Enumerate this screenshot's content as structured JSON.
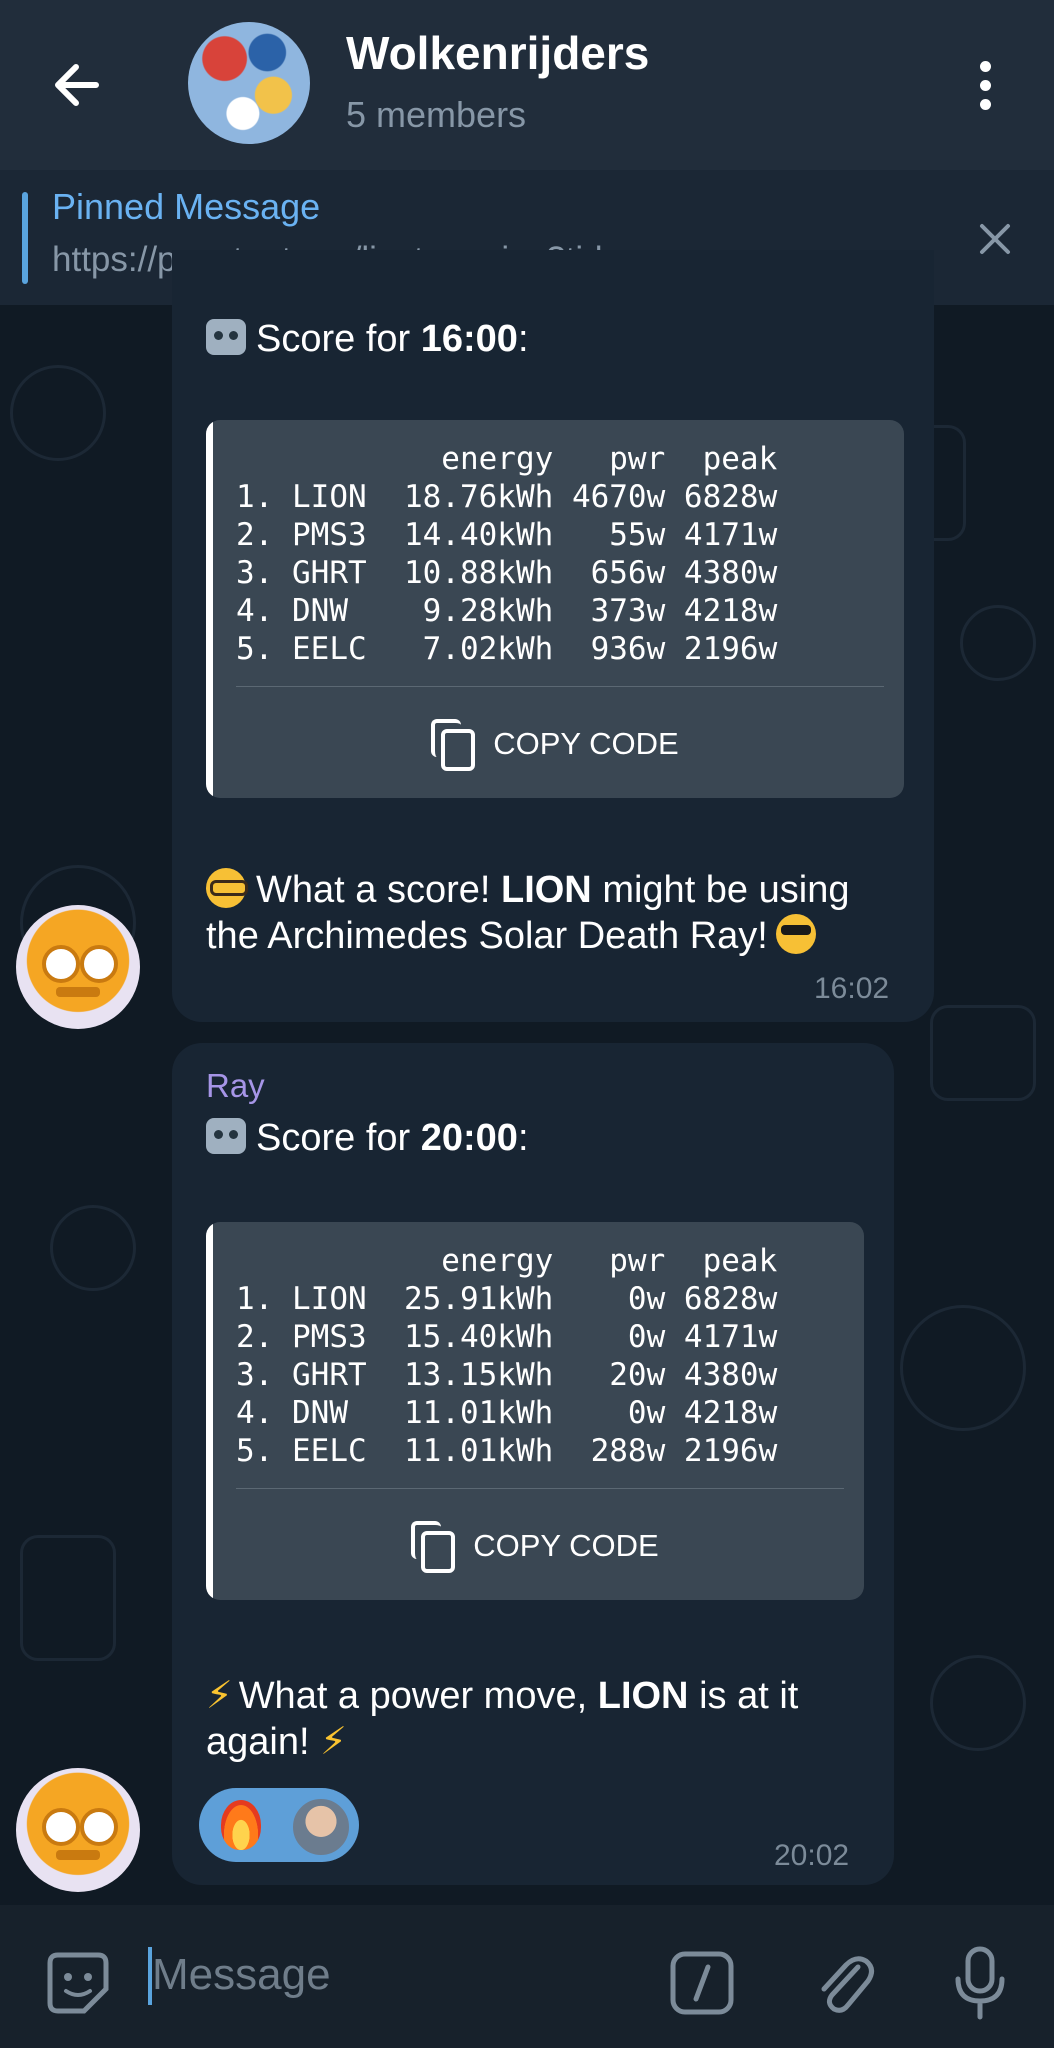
{
  "header": {
    "title": "Wolkenrijders",
    "subtitle": "5 members"
  },
  "pinned": {
    "title": "Pinned Message",
    "text": "https://pvoutput.org/liveteam.jsp?tid="
  },
  "messages": [
    {
      "sender": "",
      "heading_prefix": "Score for ",
      "heading_time": "16:00",
      "heading_suffix": ":",
      "code": "           energy   pwr  peak\n1. LION  18.76kWh 4670w 6828w\n2. PMS3  14.40kWh   55w 4171w\n3. GHRT  10.88kWh  656w 4380w\n4. DNW    9.28kWh  373w 4218w\n5. EELC   7.02kWh  936w 2196w",
      "copy_label": "COPY CODE",
      "footer_line1_a": "What a score! ",
      "footer_line1_b": "LION",
      "footer_line1_c": " might be using",
      "footer_line2": "the Archimedes Solar Death Ray!",
      "time": "16:02"
    },
    {
      "sender": "Ray",
      "heading_prefix": "Score for ",
      "heading_time": "20:00",
      "heading_suffix": ":",
      "code": "           energy   pwr  peak\n1. LION  25.91kWh    0w 6828w\n2. PMS3  15.40kWh    0w 4171w\n3. GHRT  13.15kWh   20w 4380w\n4. DNW   11.01kWh    0w 4218w\n5. EELC  11.01kWh  288w 2196w",
      "copy_label": "COPY CODE",
      "footer_line1_a": "What a power move, ",
      "footer_line1_b": "LION",
      "footer_line1_c": " is at it",
      "footer_line2": "again!",
      "time": "20:02",
      "reactions": [
        "fire",
        "avatar"
      ]
    }
  ],
  "input": {
    "placeholder": "Message"
  },
  "icons": {
    "back": "arrow-left-icon",
    "menu": "more-vertical-icon",
    "close": "close-icon",
    "sticker": "sticker-icon",
    "command": "slash-command-icon",
    "attach": "paperclip-icon",
    "mic": "microphone-icon"
  },
  "colors": {
    "header_bg": "#212d3b",
    "bubble_bg": "#182533",
    "accent_blue": "#6ab2f2",
    "sender_purple": "#a695e7",
    "code_bg": "#3a4753"
  }
}
